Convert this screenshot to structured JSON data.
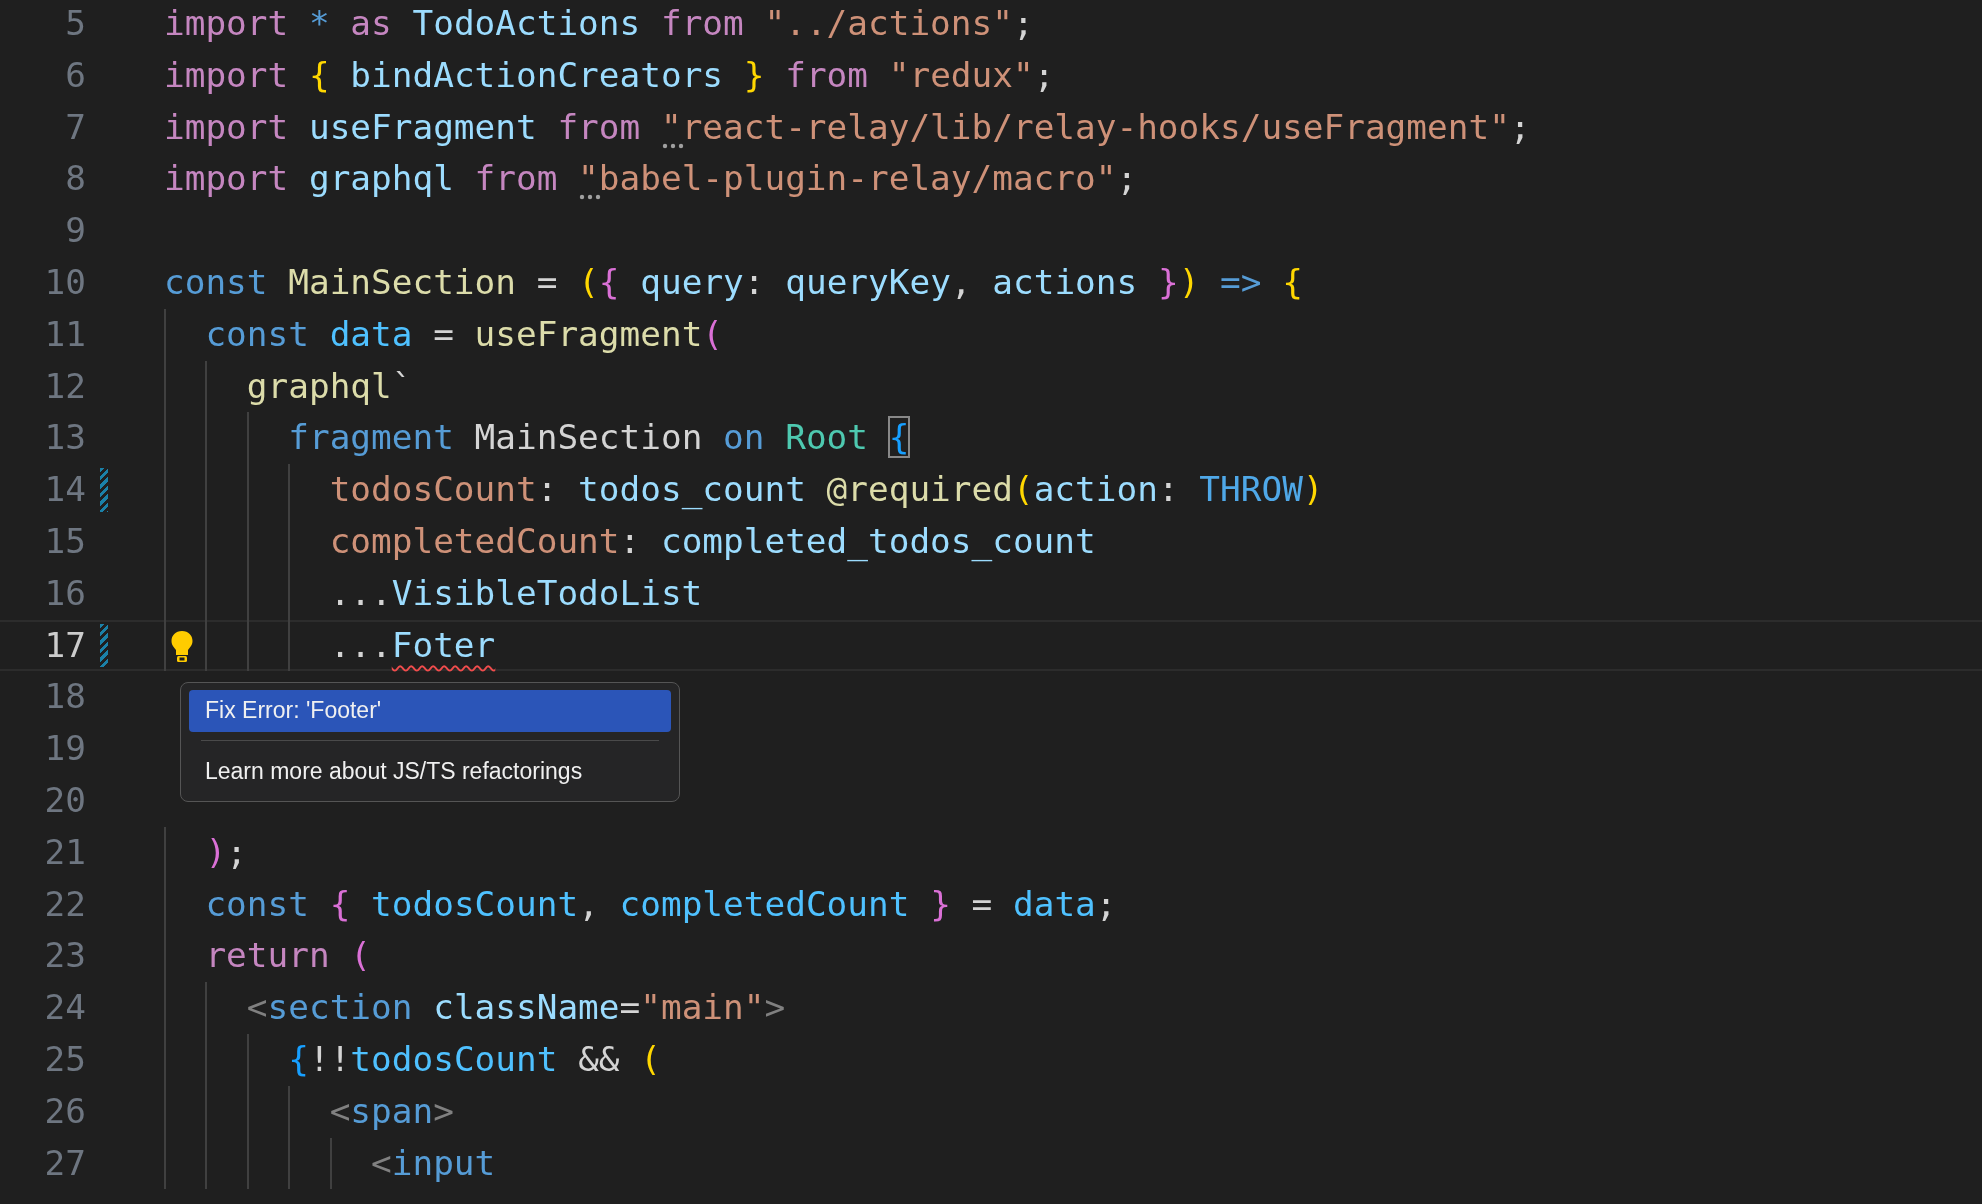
{
  "editor": {
    "lines": [
      {
        "number": "5",
        "tokens": [
          {
            "kind": "kw",
            "text": "import "
          },
          {
            "kind": "storage",
            "text": "* "
          },
          {
            "kind": "kw",
            "text": "as "
          },
          {
            "kind": "var",
            "text": "TodoActions "
          },
          {
            "kind": "kw",
            "text": "from "
          },
          {
            "kind": "str",
            "text": "\"../actions\""
          },
          {
            "kind": "punc",
            "text": ";"
          }
        ]
      },
      {
        "number": "6",
        "tokens": [
          {
            "kind": "kw",
            "text": "import "
          },
          {
            "kind": "b1",
            "text": "{ "
          },
          {
            "kind": "var",
            "text": "bindActionCreators "
          },
          {
            "kind": "b1",
            "text": "} "
          },
          {
            "kind": "kw",
            "text": "from "
          },
          {
            "kind": "str",
            "text": "\"redux\""
          },
          {
            "kind": "punc",
            "text": ";"
          }
        ]
      },
      {
        "number": "7",
        "tokens": [
          {
            "kind": "kw",
            "text": "import "
          },
          {
            "kind": "var",
            "text": "useFragment "
          },
          {
            "kind": "kw",
            "text": "from "
          },
          {
            "kind": "str",
            "text": "\"react-relay/lib/relay-hooks/useFragment\"",
            "hint": true
          },
          {
            "kind": "punc",
            "text": ";"
          }
        ]
      },
      {
        "number": "8",
        "tokens": [
          {
            "kind": "kw",
            "text": "import "
          },
          {
            "kind": "var",
            "text": "graphql "
          },
          {
            "kind": "kw",
            "text": "from "
          },
          {
            "kind": "str",
            "text": "\"babel-plugin-relay/macro\"",
            "hint": true
          },
          {
            "kind": "punc",
            "text": ";"
          }
        ]
      },
      {
        "number": "9"
      },
      {
        "number": "10",
        "tokens": [
          {
            "kind": "storage",
            "text": "const "
          },
          {
            "kind": "fn",
            "text": "MainSection"
          },
          {
            "kind": "punc",
            "text": " = "
          },
          {
            "kind": "b1",
            "text": "("
          },
          {
            "kind": "b2",
            "text": "{ "
          },
          {
            "kind": "var",
            "text": "query"
          },
          {
            "kind": "punc",
            "text": ": "
          },
          {
            "kind": "var",
            "text": "queryKey"
          },
          {
            "kind": "punc",
            "text": ", "
          },
          {
            "kind": "var",
            "text": "actions "
          },
          {
            "kind": "b2",
            "text": "}"
          },
          {
            "kind": "b1",
            "text": ") "
          },
          {
            "kind": "storage",
            "text": "=> "
          },
          {
            "kind": "b1",
            "text": "{"
          }
        ]
      },
      {
        "number": "11",
        "tokens": [
          {
            "kind": "storage",
            "text": "  const "
          },
          {
            "kind": "const",
            "text": "data"
          },
          {
            "kind": "punc",
            "text": " = "
          },
          {
            "kind": "fn",
            "text": "useFragment"
          },
          {
            "kind": "b2",
            "text": "("
          }
        ]
      },
      {
        "number": "12",
        "tokens": [
          {
            "kind": "fn",
            "text": "    graphql"
          },
          {
            "kind": "plain",
            "text": "`"
          }
        ]
      },
      {
        "number": "13",
        "tokens": [
          {
            "kind": "storage",
            "text": "      fragment "
          },
          {
            "kind": "plain",
            "text": "MainSection "
          },
          {
            "kind": "storage",
            "text": "on "
          },
          {
            "kind": "type",
            "text": "Root "
          },
          {
            "kind": "b3",
            "text": "{",
            "bracket_match": true
          }
        ]
      },
      {
        "number": "14",
        "modified": true,
        "tokens": [
          {
            "kind": "field",
            "text": "        todosCount"
          },
          {
            "kind": "punc",
            "text": ": "
          },
          {
            "kind": "var",
            "text": "todos_count "
          },
          {
            "kind": "fn",
            "text": "@required"
          },
          {
            "kind": "b1",
            "text": "("
          },
          {
            "kind": "var",
            "text": "action"
          },
          {
            "kind": "punc",
            "text": ": "
          },
          {
            "kind": "enum",
            "text": "THROW"
          },
          {
            "kind": "b1",
            "text": ")"
          }
        ]
      },
      {
        "number": "15",
        "tokens": [
          {
            "kind": "field",
            "text": "        completedCount"
          },
          {
            "kind": "punc",
            "text": ": "
          },
          {
            "kind": "var",
            "text": "completed_todos_count"
          }
        ]
      },
      {
        "number": "16",
        "tokens": [
          {
            "kind": "plain",
            "text": "        ..."
          },
          {
            "kind": "var",
            "text": "VisibleTodoList"
          }
        ]
      },
      {
        "number": "17",
        "modified": true,
        "current": true,
        "lightbulb": true,
        "tokens": [
          {
            "kind": "plain",
            "text": "        ..."
          },
          {
            "kind": "var",
            "text": "Foter",
            "error": true
          }
        ]
      },
      {
        "number": "18"
      },
      {
        "number": "19"
      },
      {
        "number": "20"
      },
      {
        "number": "21",
        "tokens": [
          {
            "kind": "b2",
            "text": "  )"
          },
          {
            "kind": "punc",
            "text": ";"
          }
        ]
      },
      {
        "number": "22",
        "tokens": [
          {
            "kind": "storage",
            "text": "  const "
          },
          {
            "kind": "b2",
            "text": "{ "
          },
          {
            "kind": "const",
            "text": "todosCount"
          },
          {
            "kind": "punc",
            "text": ", "
          },
          {
            "kind": "const",
            "text": "completedCount "
          },
          {
            "kind": "b2",
            "text": "}"
          },
          {
            "kind": "punc",
            "text": " = "
          },
          {
            "kind": "const",
            "text": "data"
          },
          {
            "kind": "punc",
            "text": ";"
          }
        ]
      },
      {
        "number": "23",
        "tokens": [
          {
            "kind": "kw",
            "text": "  return "
          },
          {
            "kind": "b2",
            "text": "("
          }
        ]
      },
      {
        "number": "24",
        "tokens": [
          {
            "kind": "tag",
            "text": "    <"
          },
          {
            "kind": "storage",
            "text": "section "
          },
          {
            "kind": "var",
            "text": "className"
          },
          {
            "kind": "punc",
            "text": "="
          },
          {
            "kind": "str",
            "text": "\"main\""
          },
          {
            "kind": "tag",
            "text": ">"
          }
        ]
      },
      {
        "number": "25",
        "tokens": [
          {
            "kind": "b3",
            "text": "      {"
          },
          {
            "kind": "plain",
            "text": "!!"
          },
          {
            "kind": "const",
            "text": "todosCount"
          },
          {
            "kind": "plain",
            "text": " && "
          },
          {
            "kind": "b1",
            "text": "("
          }
        ]
      },
      {
        "number": "26",
        "tokens": [
          {
            "kind": "tag",
            "text": "        <"
          },
          {
            "kind": "storage",
            "text": "span"
          },
          {
            "kind": "tag",
            "text": ">"
          }
        ]
      },
      {
        "number": "27",
        "tokens": [
          {
            "kind": "tag",
            "text": "          <"
          },
          {
            "kind": "storage",
            "text": "input"
          }
        ]
      }
    ]
  },
  "quick_fix_menu": {
    "items": [
      {
        "kind": "action",
        "label": "Fix Error: 'Footer'",
        "selected": true
      },
      {
        "kind": "separator"
      },
      {
        "kind": "action",
        "label": "Learn more about JS/TS refactorings",
        "selected": false
      }
    ]
  }
}
